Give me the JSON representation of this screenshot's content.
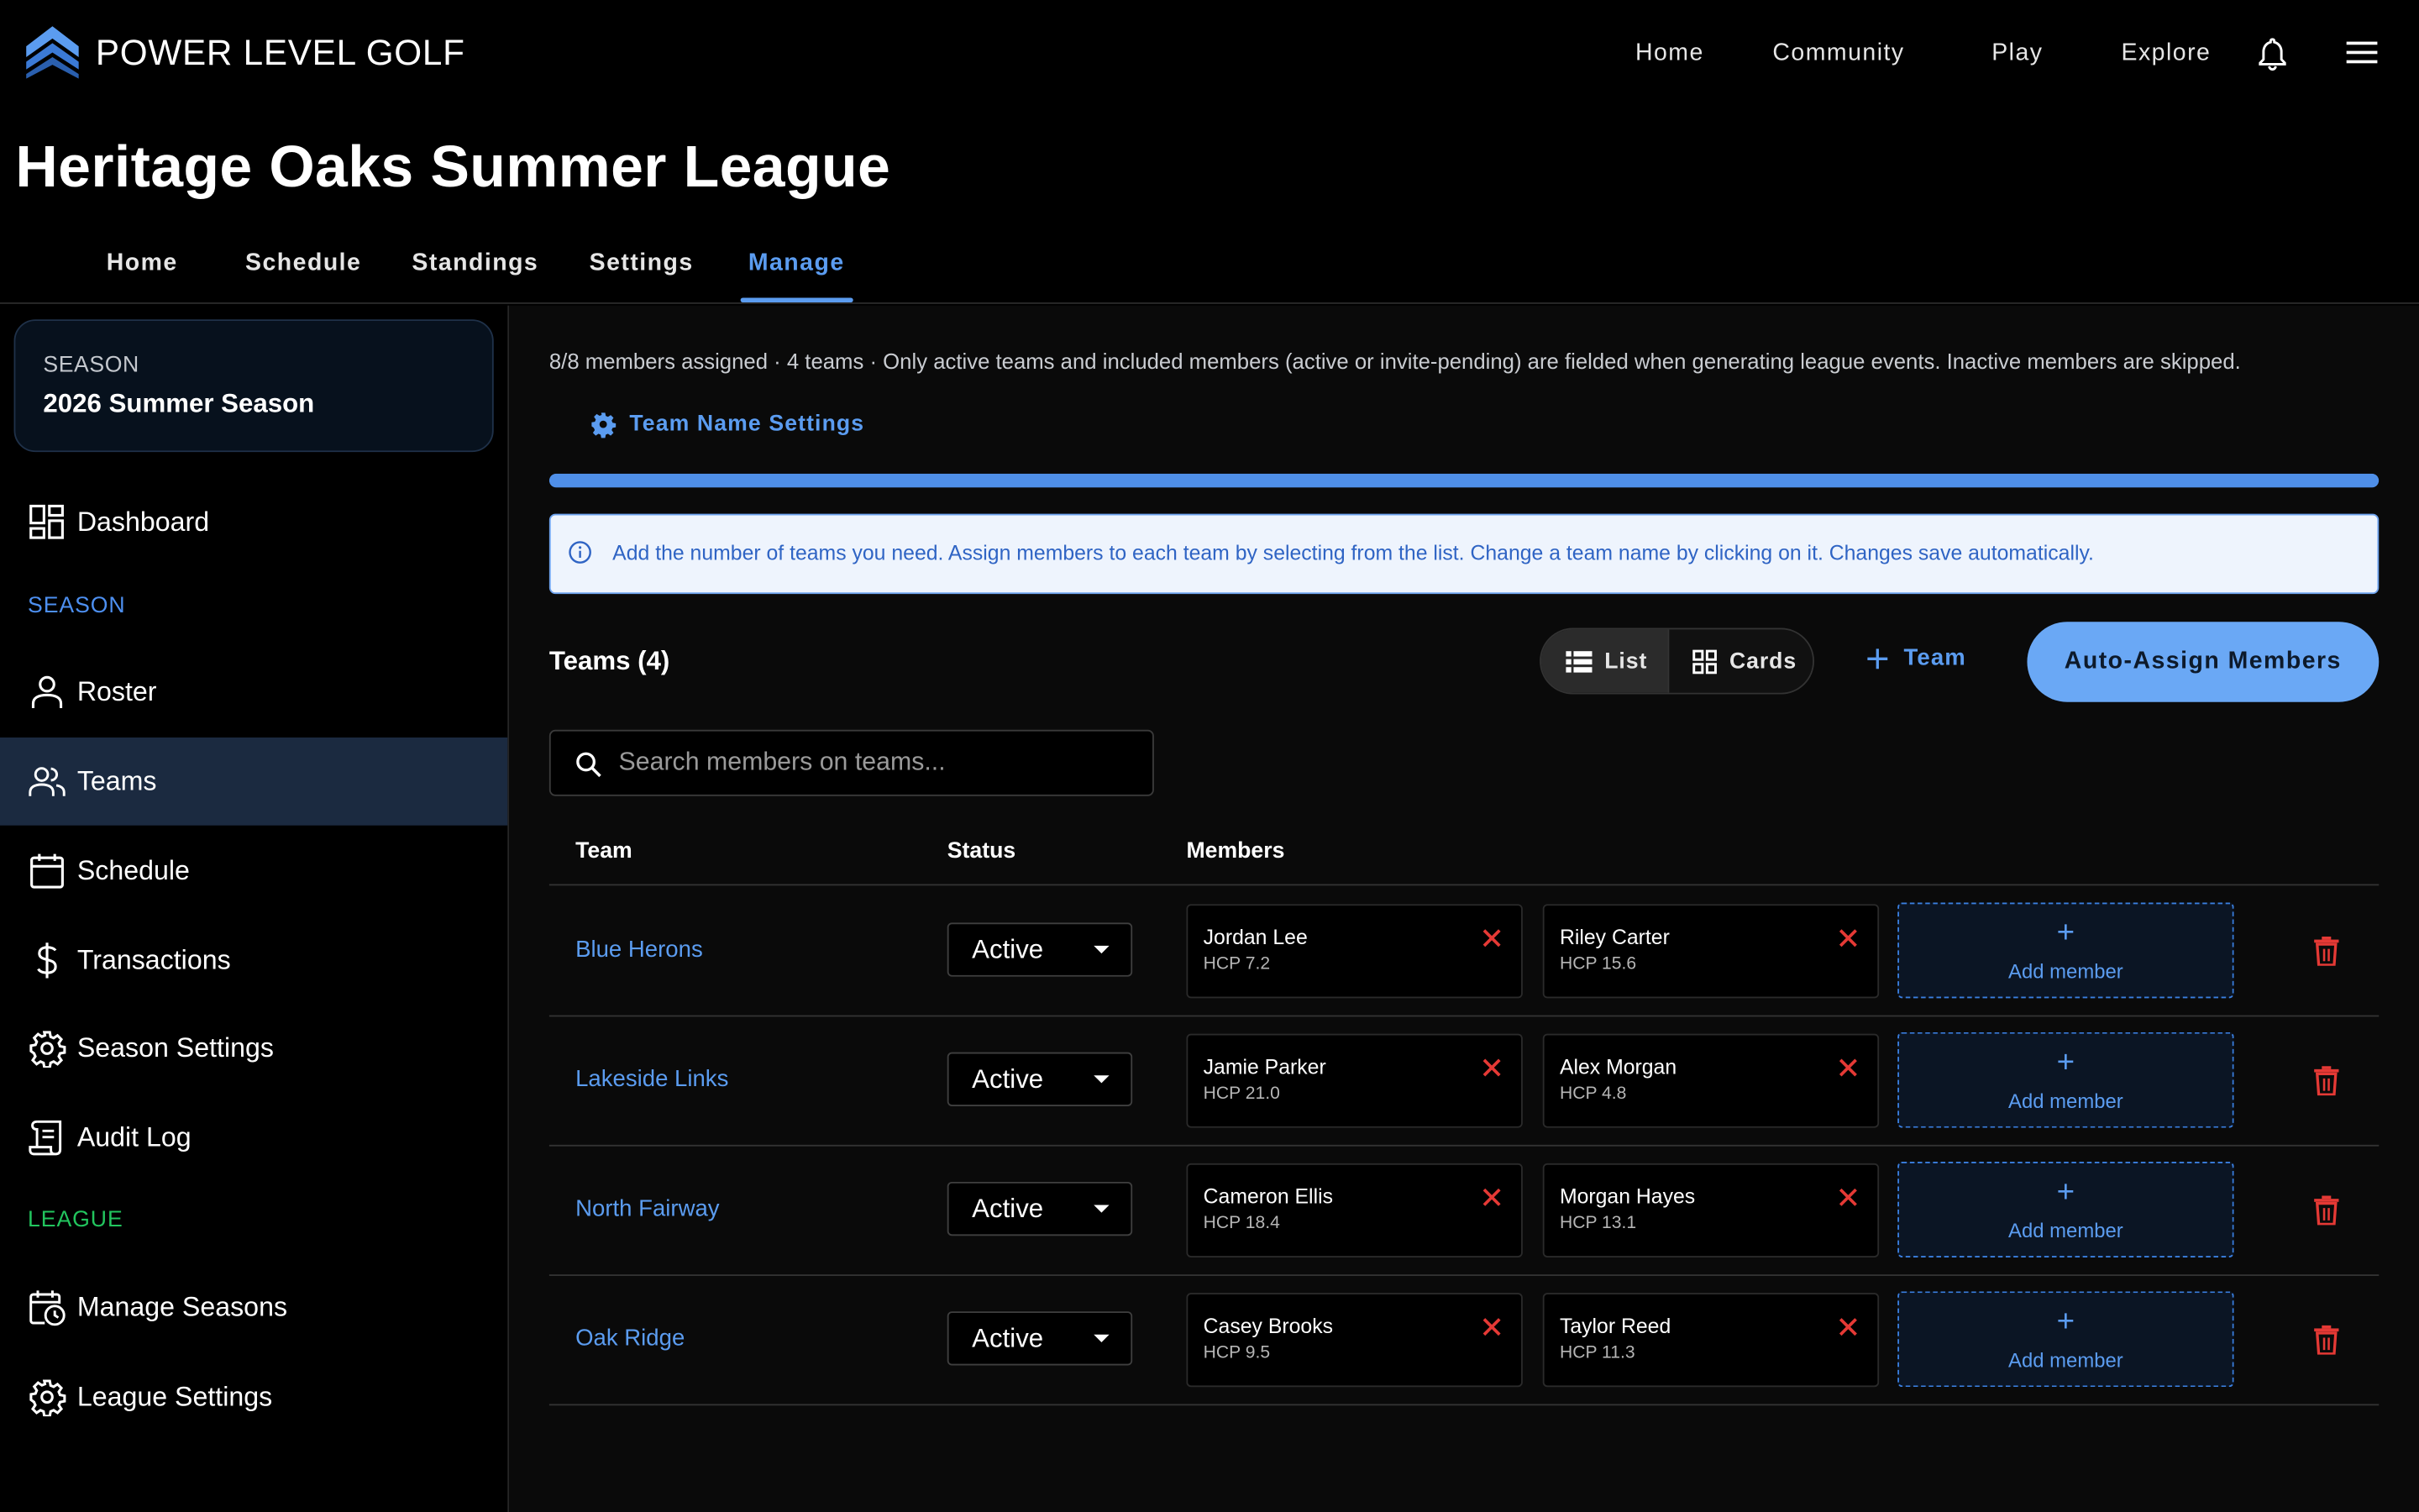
{
  "brand": {
    "name": "POWER LEVEL GOLF"
  },
  "topnav": {
    "items": [
      "Home",
      "Community",
      "Play",
      "Explore"
    ]
  },
  "page_title": "Heritage Oaks Summer League",
  "tabs": [
    {
      "label": "Home"
    },
    {
      "label": "Schedule"
    },
    {
      "label": "Standings"
    },
    {
      "label": "Settings"
    },
    {
      "label": "Manage",
      "active": true
    }
  ],
  "sidebar": {
    "season_card": {
      "label": "SEASON",
      "value": "2026 Summer Season"
    },
    "dashboard": "Dashboard",
    "season_heading": "SEASON",
    "season_items": [
      "Roster",
      "Teams",
      "Schedule",
      "Transactions",
      "Season Settings",
      "Audit Log"
    ],
    "selected": "Teams",
    "league_heading": "LEAGUE",
    "league_items": [
      "Manage Seasons",
      "League Settings"
    ]
  },
  "main": {
    "summary": "8/8 members assigned · 4 teams · Only active teams and included members (active or invite-pending) are fielded when generating league events. Inactive members are skipped.",
    "team_name_settings": "Team Name Settings",
    "progress": 1.0,
    "info": "Add the number of teams you need. Assign members to each team by selecting from the list. Change a team name by clicking on it. Changes save automatically.",
    "teams_heading": "Teams (4)",
    "view_list": "List",
    "view_cards": "Cards",
    "view_selected": "List",
    "add_team": "Team",
    "auto_assign": "Auto-Assign Members",
    "search_placeholder": "Search members on teams...",
    "columns": {
      "team": "Team",
      "status": "Status",
      "members": "Members"
    },
    "add_member": "Add member",
    "teams": [
      {
        "name": "Blue Herons",
        "status": "Active",
        "members": [
          {
            "name": "Jordan Lee",
            "hcp": "HCP 7.2"
          },
          {
            "name": "Riley Carter",
            "hcp": "HCP 15.6"
          }
        ]
      },
      {
        "name": "Lakeside Links",
        "status": "Active",
        "members": [
          {
            "name": "Jamie Parker",
            "hcp": "HCP 21.0"
          },
          {
            "name": "Alex Morgan",
            "hcp": "HCP 4.8"
          }
        ]
      },
      {
        "name": "North Fairway",
        "status": "Active",
        "members": [
          {
            "name": "Cameron Ellis",
            "hcp": "HCP 18.4"
          },
          {
            "name": "Morgan Hayes",
            "hcp": "HCP 13.1"
          }
        ]
      },
      {
        "name": "Oak Ridge",
        "status": "Active",
        "members": [
          {
            "name": "Casey Brooks",
            "hcp": "HCP 9.5"
          },
          {
            "name": "Taylor Reed",
            "hcp": "HCP 11.3"
          }
        ]
      }
    ]
  },
  "colors": {
    "accent": "#5b9cf0",
    "season_heading": "#4d8ff0",
    "league_heading": "#22c55e",
    "danger": "#e53935"
  }
}
